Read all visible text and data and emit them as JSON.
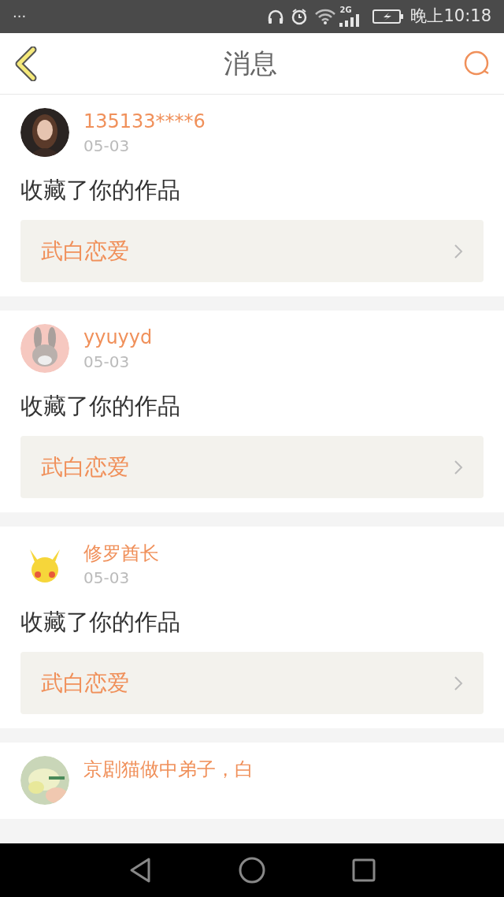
{
  "status_bar": {
    "notifications": "···",
    "network": "2G",
    "time": "晚上10:18"
  },
  "header": {
    "title": "消息"
  },
  "messages": [
    {
      "user": "135133****6",
      "date": "05-03",
      "action": "收藏了你的作品",
      "work": "武白恋爱"
    },
    {
      "user": "yyuyyd",
      "date": "05-03",
      "action": "收藏了你的作品",
      "work": "武白恋爱"
    },
    {
      "user": "修罗酋长",
      "date": "05-03",
      "action": "收藏了你的作品",
      "work": "武白恋爱"
    },
    {
      "user": "京剧猫做中弟子，白"
    }
  ]
}
